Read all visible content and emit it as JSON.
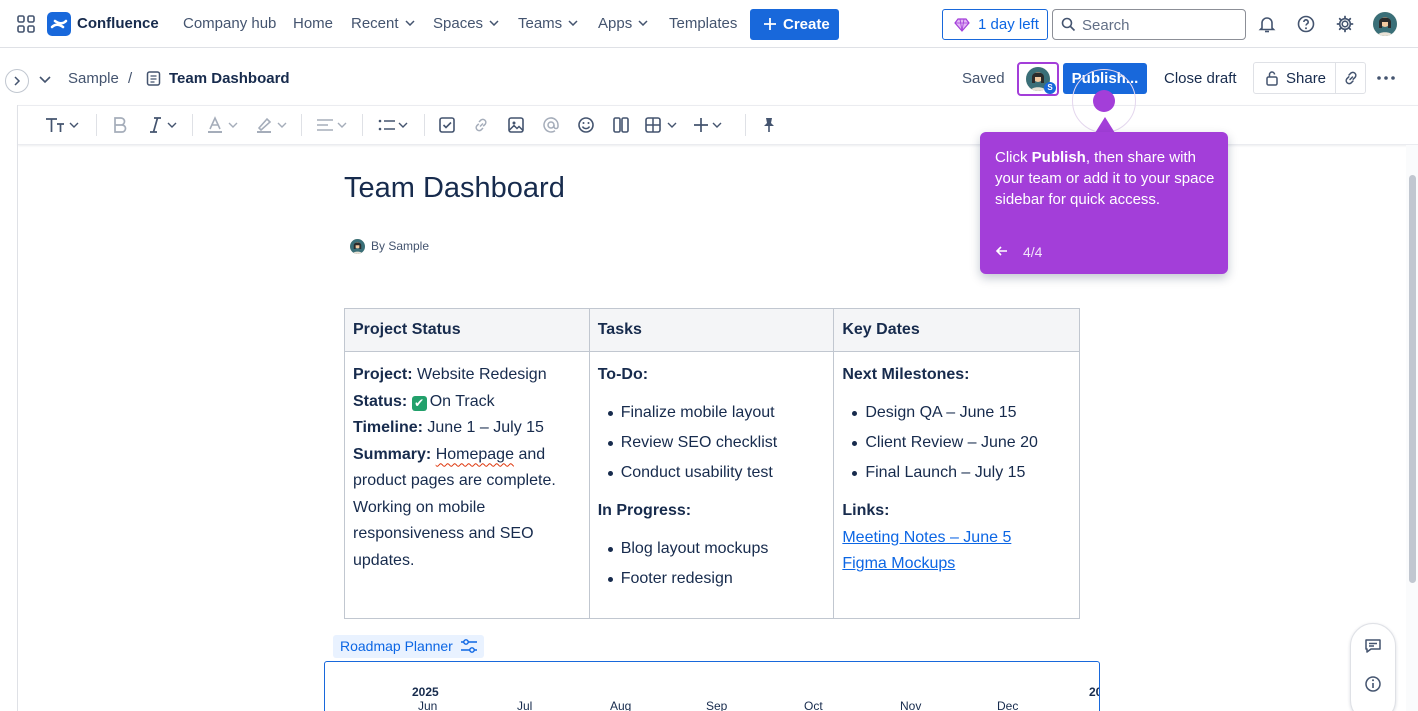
{
  "app": {
    "name": "Confluence",
    "brand_color": "#1868db",
    "tour_color": "#a33ed9"
  },
  "topnav": {
    "items": [
      "Company hub",
      "Home",
      "Recent",
      "Spaces",
      "Teams",
      "Apps",
      "Templates"
    ],
    "create_label": "Create",
    "trial_label": "1 day left",
    "search_placeholder": "Search"
  },
  "breadcrumb": {
    "space": "Sample",
    "separator": "/",
    "page": "Team Dashboard"
  },
  "actions": {
    "saved": "Saved",
    "collaborator_initial": "S",
    "publish": "Publish...",
    "close_draft": "Close draft",
    "share": "Share"
  },
  "page": {
    "title": "Team Dashboard",
    "byline": "By Sample"
  },
  "table": {
    "headers": [
      "Project Status",
      "Tasks",
      "Key Dates"
    ],
    "status": {
      "project_label": "Project:",
      "project_value": "Website Redesign",
      "status_label": "Status:",
      "status_icon": "✔",
      "status_value": "On Track",
      "timeline_label": "Timeline:",
      "timeline_value": "June 1 – July 15",
      "summary_label": "Summary:",
      "summary_word": "Homepage",
      "summary_rest": "and product pages are complete. Working on mobile responsiveness and SEO updates."
    },
    "tasks": {
      "todo_heading": "To-Do:",
      "todo": [
        "Finalize mobile layout",
        "Review SEO checklist",
        "Conduct usability test"
      ],
      "progress_heading": "In Progress:",
      "progress": [
        "Blog layout mockups",
        "Footer redesign"
      ]
    },
    "dates": {
      "milestones_heading": "Next Milestones:",
      "milestones": [
        "Design QA – June 15",
        "Client Review – June 20",
        "Final Launch – July 15"
      ],
      "links_heading": "Links:",
      "links": [
        "Meeting Notes – June 5",
        "Figma Mockups"
      ]
    }
  },
  "roadmap": {
    "label": "Roadmap Planner",
    "year": "2025",
    "year_next": "20",
    "months": [
      "Jun",
      "Jul",
      "Aug",
      "Sep",
      "Oct",
      "Nov",
      "Dec"
    ]
  },
  "tour": {
    "text_before": "Click ",
    "text_bold": "Publish",
    "text_after": ", then share with your team or add it to your space sidebar for quick access.",
    "step": "4/4"
  }
}
